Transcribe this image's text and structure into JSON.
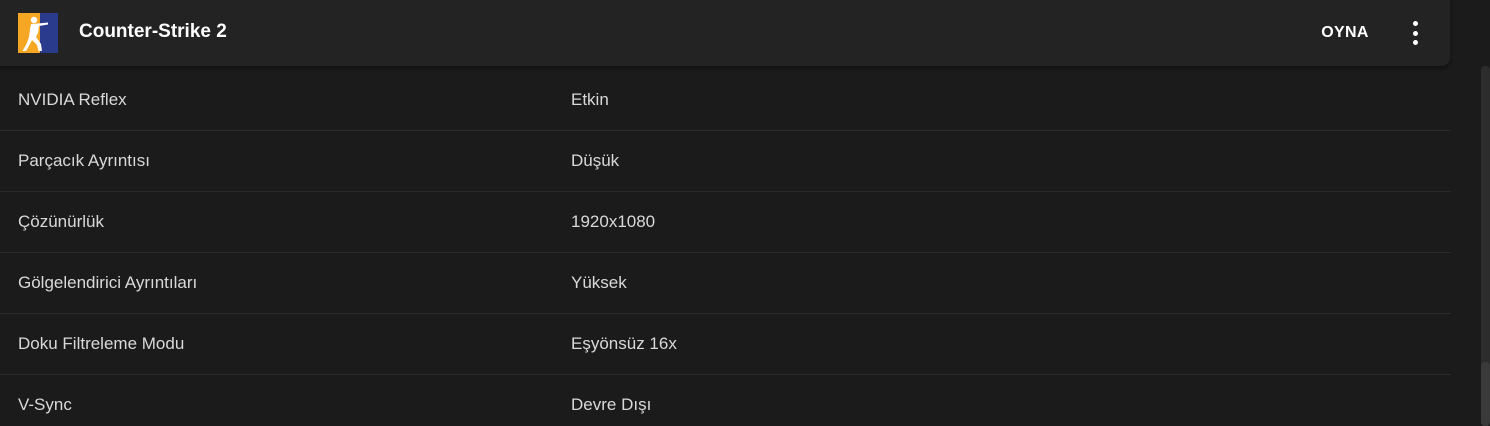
{
  "header": {
    "game_title": "Counter-Strike 2",
    "play_label": "OYNA",
    "logo_icon": "counter-strike-logo-icon",
    "more_icon": "more-vertical-icon",
    "logo_colors": {
      "background": "#f5a623",
      "stripe": "#2a3a8c",
      "figure": "#ffffff"
    }
  },
  "settings": [
    {
      "label": "NVIDIA Reflex",
      "value": "Etkin"
    },
    {
      "label": "Parçacık Ayrıntısı",
      "value": "Düşük"
    },
    {
      "label": "Çözünürlük",
      "value": "1920x1080"
    },
    {
      "label": "Gölgelendirici Ayrıntıları",
      "value": "Yüksek"
    },
    {
      "label": "Doku Filtreleme Modu",
      "value": "Eşyönsüz 16x"
    },
    {
      "label": "V-Sync",
      "value": "Devre Dışı"
    }
  ]
}
